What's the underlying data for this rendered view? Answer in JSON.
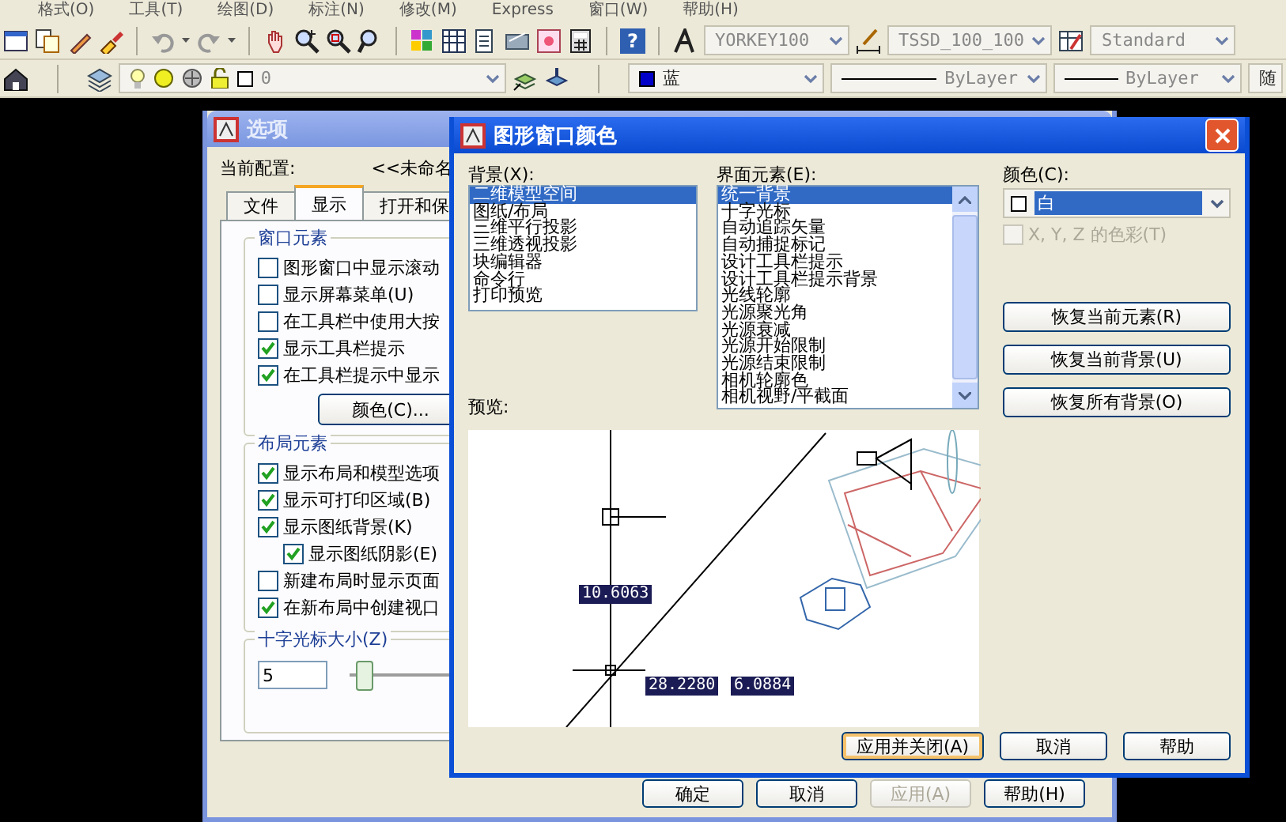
{
  "menu_bar": [
    "格式(O)",
    "工具(T)",
    "绘图(D)",
    "标注(N)",
    "修改(M)",
    "Express",
    "窗口(W)",
    "帮助(H)"
  ],
  "toolbar_top": {
    "help_icon": "?",
    "text_style": "YORKEY100",
    "dim_style": "TSSD_100_100",
    "table_style": "Standard"
  },
  "toolbar_layers": {
    "layer": "0",
    "color_name": "蓝",
    "linetype": "ByLayer",
    "lineweight": "ByLayer",
    "plot_style": "随"
  },
  "options_dialog": {
    "title": "选项",
    "profile_label": "当前配置:",
    "profile_value": "<<未命名",
    "tabs": [
      {
        "label": "文件",
        "selected": false
      },
      {
        "label": "显示",
        "selected": true
      },
      {
        "label": "打开和保",
        "selected": false
      }
    ],
    "window_elements": {
      "title": "窗口元素",
      "checkboxes": [
        {
          "label": "图形窗口中显示滚动",
          "checked": false
        },
        {
          "label": "显示屏幕菜单(U)",
          "checked": false
        },
        {
          "label": "在工具栏中使用大按",
          "checked": false
        },
        {
          "label": "显示工具栏提示",
          "checked": true
        },
        {
          "label": "在工具栏提示中显示",
          "checked": true
        }
      ],
      "colors_button": "颜色(C)..."
    },
    "layout_elements": {
      "title": "布局元素",
      "checkboxes": [
        {
          "label": "显示布局和模型选项",
          "checked": true
        },
        {
          "label": "显示可打印区域(B)",
          "checked": true
        },
        {
          "label": "显示图纸背景(K)",
          "checked": true,
          "children": [
            {
              "label": "显示图纸阴影(E)",
              "checked": true
            }
          ]
        },
        {
          "label": "新建布局时显示页面",
          "checked": false
        },
        {
          "label": "在新布局中创建视口",
          "checked": true
        }
      ]
    },
    "crosshair": {
      "title": "十字光标大小(Z)",
      "value": "5",
      "level": 0.02
    },
    "buttons": [
      {
        "label": "确定",
        "disabled": false
      },
      {
        "label": "取消",
        "disabled": false
      },
      {
        "label": "应用(A)",
        "disabled": true
      },
      {
        "label": "帮助(H)",
        "disabled": false
      }
    ]
  },
  "color_dialog": {
    "title": "图形窗口颜色",
    "context": {
      "label": "背景(X):",
      "items": [
        {
          "label": "二维模型空间",
          "selected": true
        },
        {
          "label": "图纸/布局",
          "selected": false
        },
        {
          "label": "三维平行投影",
          "selected": false
        },
        {
          "label": "三维透视投影",
          "selected": false
        },
        {
          "label": "块编辑器",
          "selected": false
        },
        {
          "label": "命令行",
          "selected": false
        },
        {
          "label": "打印预览",
          "selected": false
        }
      ]
    },
    "interface_element": {
      "label": "界面元素(E):",
      "items": [
        {
          "label": "统一背景",
          "selected": true
        },
        {
          "label": "十字光标",
          "selected": false
        },
        {
          "label": "自动追踪矢量",
          "selected": false
        },
        {
          "label": "自动捕捉标记",
          "selected": false
        },
        {
          "label": "设计工具栏提示",
          "selected": false
        },
        {
          "label": "设计工具栏提示背景",
          "selected": false
        },
        {
          "label": "光线轮廓",
          "selected": false
        },
        {
          "label": "光源聚光角",
          "selected": false
        },
        {
          "label": "光源衰减",
          "selected": false
        },
        {
          "label": "光源开始限制",
          "selected": false
        },
        {
          "label": "光源结束限制",
          "selected": false
        },
        {
          "label": "相机轮廓色",
          "selected": false
        },
        {
          "label": "相机视野/平截面",
          "selected": false
        }
      ]
    },
    "color": {
      "label": "颜色(C):",
      "value": "白"
    },
    "tint_xyz": {
      "label": "X, Y, Z 的色彩(T)",
      "checked": false,
      "disabled": true
    },
    "restore_buttons": [
      "恢复当前元素(R)",
      "恢复当前背景(U)",
      "恢复所有背景(O)"
    ],
    "preview": {
      "label": "预览:",
      "readouts": [
        "10.6063",
        "28.2280",
        "6.0884"
      ]
    },
    "buttons": [
      {
        "label": "应用并关闭(A)",
        "default": true
      },
      {
        "label": "取消",
        "default": false
      },
      {
        "label": "帮助",
        "default": false
      }
    ]
  }
}
